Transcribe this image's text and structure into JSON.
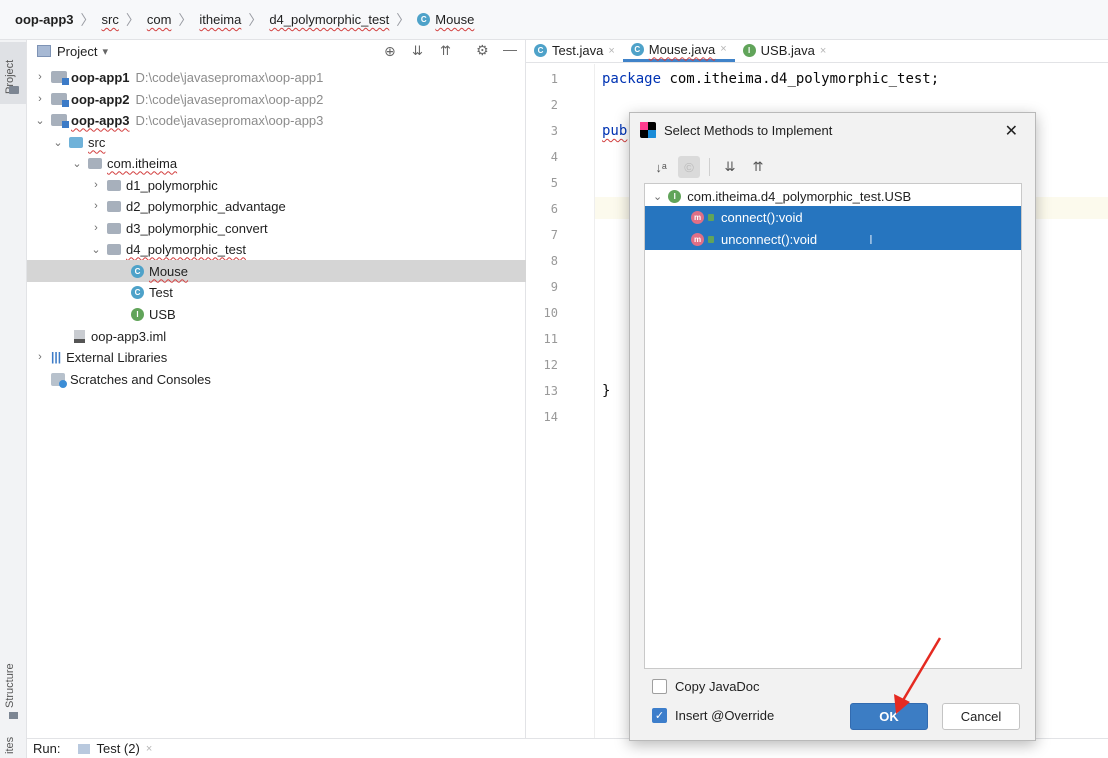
{
  "breadcrumb": {
    "items": [
      "oop-app3",
      "src",
      "com",
      "itheima",
      "d4_polymorphic_test",
      "Mouse"
    ],
    "class_icon": "C"
  },
  "side_tabs": {
    "project": "Project",
    "structure": "Structure",
    "favorites": "ites"
  },
  "project_panel": {
    "title": "Project",
    "title_dropdown": "▾",
    "toolbar_icons": [
      "target-icon",
      "expand-all-icon",
      "collapse-all-icon",
      "gear-icon",
      "minimize-icon"
    ],
    "tree": [
      {
        "name": "oop-app1",
        "path": "D:\\code\\javasepromax\\oop-app1"
      },
      {
        "name": "oop-app2",
        "path": "D:\\code\\javasepromax\\oop-app2"
      },
      {
        "name": "oop-app3",
        "path": "D:\\code\\javasepromax\\oop-app3"
      },
      {
        "name": "src"
      },
      {
        "name": "com.itheima"
      },
      {
        "name": "d1_polymorphic"
      },
      {
        "name": "d2_polymorphic_advantage"
      },
      {
        "name": "d3_polymorphic_convert"
      },
      {
        "name": "d4_polymorphic_test"
      },
      {
        "name": "Mouse",
        "icon": "C"
      },
      {
        "name": "Test",
        "icon": "C"
      },
      {
        "name": "USB",
        "icon": "I"
      },
      {
        "name": "oop-app3.iml"
      },
      {
        "name": "External Libraries"
      },
      {
        "name": "Scratches and Consoles"
      }
    ]
  },
  "editor": {
    "tabs": [
      {
        "label": "Test.java",
        "icon": "C",
        "close": "×"
      },
      {
        "label": "Mouse.java",
        "icon": "C",
        "close": "×"
      },
      {
        "label": "USB.java",
        "icon": "I",
        "close": "×"
      }
    ],
    "line_numbers": [
      "1",
      "2",
      "3",
      "4",
      "5",
      "6",
      "7",
      "8",
      "9",
      "10",
      "11",
      "12",
      "13",
      "14"
    ],
    "code": {
      "line1_kw": "package",
      "line1_rest": " com.itheima.d4_polymorphic_test;",
      "line3_kw": "pub",
      "line13": "}"
    }
  },
  "dialog": {
    "title": "Select Methods to Implement",
    "close": "✕",
    "interface_icon": "I",
    "interface": "com.itheima.d4_polymorphic_test.USB",
    "method_icon": "m",
    "methods": [
      "connect():void",
      "unconnect():void"
    ],
    "copy_javadoc": "Copy JavaDoc",
    "insert_override": "Insert @Override",
    "ok": "OK",
    "cancel": "Cancel",
    "annotation_color": "#e52a21"
  },
  "bottom_bar": {
    "run": "Run:",
    "tab": "Test (2)",
    "close": "×"
  }
}
